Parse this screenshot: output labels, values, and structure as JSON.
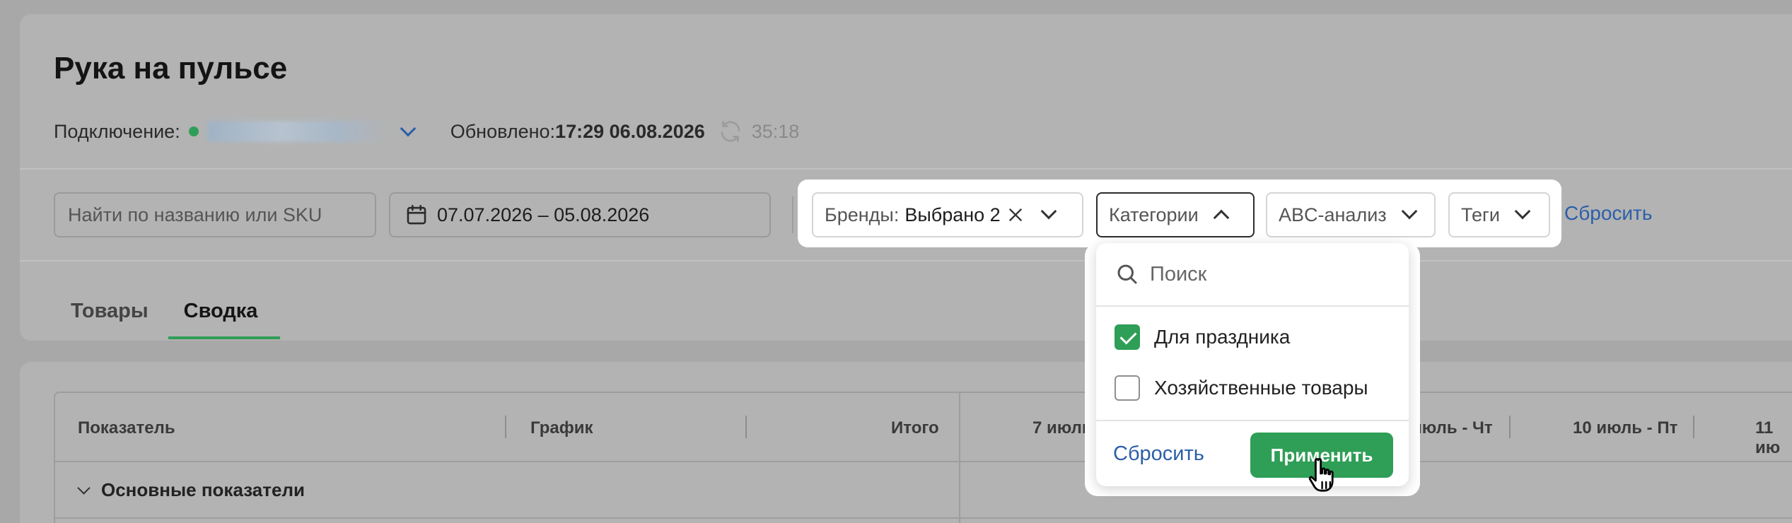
{
  "page": {
    "title": "Рука на пульсе"
  },
  "connection": {
    "label": "Подключение:",
    "status_color": "#2f9e57",
    "updated_label": "Обновлено:",
    "updated_value": "17:29 06.08.2026",
    "timer": "35:18"
  },
  "filters": {
    "search_placeholder": "Найти по названию или SKU",
    "date_range": "07.07.2026 – 05.08.2026",
    "brands_label": "Бренды:",
    "brands_value": "Выбрано 2",
    "categories_label": "Категории",
    "abc_label": "ABC-анализ",
    "tags_label": "Теги",
    "reset_label": "Сбросить"
  },
  "tabs": [
    {
      "label": "Товары",
      "active": false
    },
    {
      "label": "Сводка",
      "active": true
    }
  ],
  "table": {
    "headers": {
      "metric": "Показатель",
      "chart": "График",
      "total": "Итого",
      "col_jul7": "7 июль -",
      "col_jul9": "июль - Чт",
      "col_jul10": "10 июль - Пт",
      "col_jul11": "11 ию"
    },
    "group_label": "Основные показатели"
  },
  "category_dropdown": {
    "search_placeholder": "Поиск",
    "options": [
      {
        "label": "Для праздника",
        "checked": true
      },
      {
        "label": "Хозяйственные товары",
        "checked": false
      }
    ],
    "reset_label": "Сбросить",
    "apply_label": "Применить"
  },
  "colors": {
    "accent_green": "#2f9e57",
    "link_blue": "#2b5fa8",
    "dim_overlay": "#a8a8a8"
  }
}
